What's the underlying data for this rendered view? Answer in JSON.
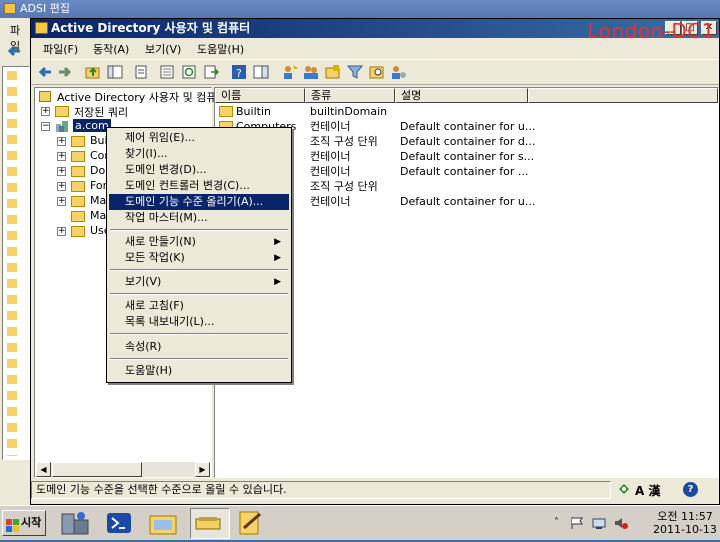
{
  "back_window": {
    "title": "ADSI 편집",
    "menu_label": "파일"
  },
  "front_window": {
    "title": "Active Directory 사용자 및 컴퓨터",
    "watermark": "London-DC1",
    "menu": [
      "파일(F)",
      "동작(A)",
      "보기(V)",
      "도움말(H)"
    ]
  },
  "tree": {
    "root": "Active Directory 사용자 및 컴퓨터",
    "saved_queries": "저장된 쿼리",
    "domain": "a.com",
    "children": [
      "Bui",
      "Com",
      "Dom",
      "For",
      "Ma",
      "Ma",
      "Use"
    ]
  },
  "list": {
    "columns": [
      "이름",
      "종류",
      "설명"
    ],
    "rows": [
      {
        "name": "Builtin",
        "type": "builtinDomain",
        "desc": ""
      },
      {
        "name": "Computers",
        "type": "컨테이너",
        "desc": "Default container for u..."
      },
      {
        "name": "",
        "type": "조직 구성 단위",
        "desc": "Default container for d..."
      },
      {
        "name": "",
        "type": "컨테이너",
        "desc": "Default container for s..."
      },
      {
        "name": "",
        "type": "컨테이너",
        "desc": "Default container for ..."
      },
      {
        "name": "",
        "type": "조직 구성 단위",
        "desc": ""
      },
      {
        "name": "",
        "type": "컨테이너",
        "desc": "Default container for u..."
      }
    ]
  },
  "context_menu": {
    "items": [
      "제어 위임(E)...",
      "찾기(I)...",
      "도메인 변경(D)...",
      "도메인 컨트롤러 변경(C)...",
      "도메인 기능 수준 올리기(A)...",
      "작업 마스터(M)...",
      "새로 만들기(N)",
      "모든 작업(K)",
      "보기(V)",
      "새로 고침(F)",
      "목록 내보내기(L)...",
      "속성(R)",
      "도움말(H)"
    ]
  },
  "status": {
    "text": "도메인 기능 수준을 선택한 수준으로 올릴 수 있습니다.",
    "ime": "A 漢"
  },
  "taskbar": {
    "start": "시작",
    "clock_period": "오전 11:57",
    "clock_date": "2011-10-13"
  }
}
